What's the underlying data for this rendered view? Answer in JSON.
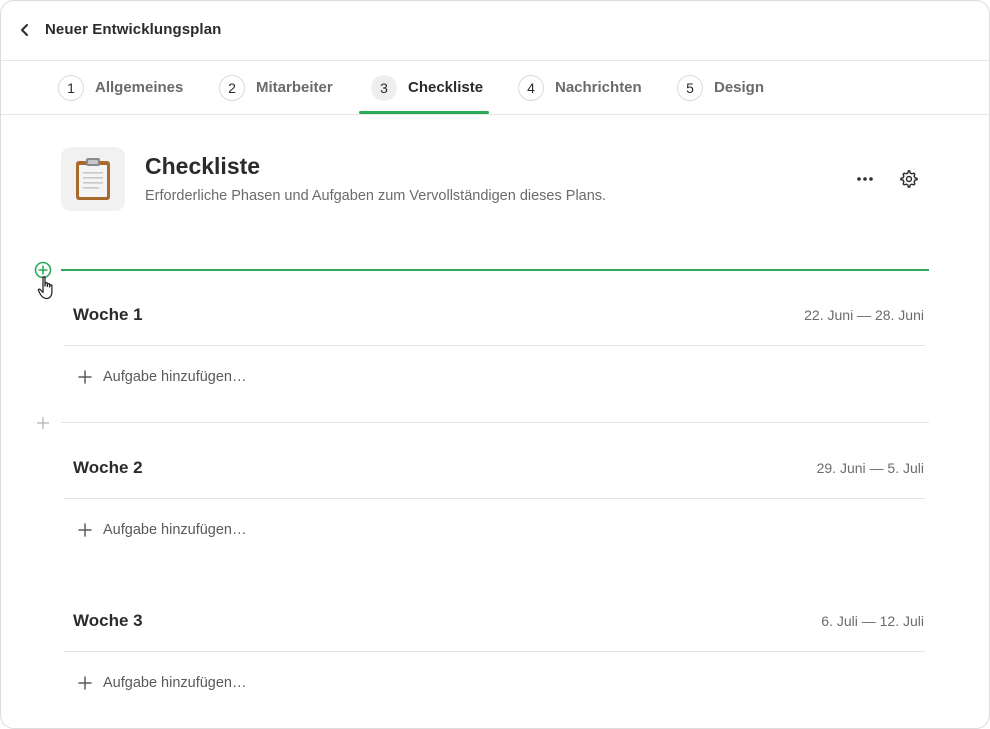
{
  "header": {
    "back_icon": "chevron-left-icon",
    "title": "Neuer Entwicklungsplan"
  },
  "tabs": [
    {
      "num": "1",
      "label": "Allgemeines",
      "active": false
    },
    {
      "num": "2",
      "label": "Mitarbeiter",
      "active": false
    },
    {
      "num": "3",
      "label": "Checkliste",
      "active": true
    },
    {
      "num": "4",
      "label": "Nachrichten",
      "active": false
    },
    {
      "num": "5",
      "label": "Design",
      "active": false
    }
  ],
  "section": {
    "icon": "clipboard-icon",
    "title": "Checkliste",
    "subtitle": "Erforderliche Phasen und Aufgaben zum Vervollständigen dieses Plans.",
    "more_icon": "more-horizontal-icon",
    "settings_icon": "gear-icon"
  },
  "weeks": [
    {
      "title": "Woche 1",
      "range": "22. Juni — 28. Juni",
      "add_task_label": "Aufgabe hinzufügen…"
    },
    {
      "title": "Woche 2",
      "range": "29. Juni — 5. Juli",
      "add_task_label": "Aufgabe hinzufügen…"
    },
    {
      "title": "Woche 3",
      "range": "6. Juli — 12. Juli",
      "add_task_label": "Aufgabe hinzufügen…"
    }
  ],
  "colors": {
    "accent": "#2eaa5c",
    "text": "#2b2b2b",
    "muted": "#6b6b6b",
    "divider": "#e3e3e3"
  }
}
